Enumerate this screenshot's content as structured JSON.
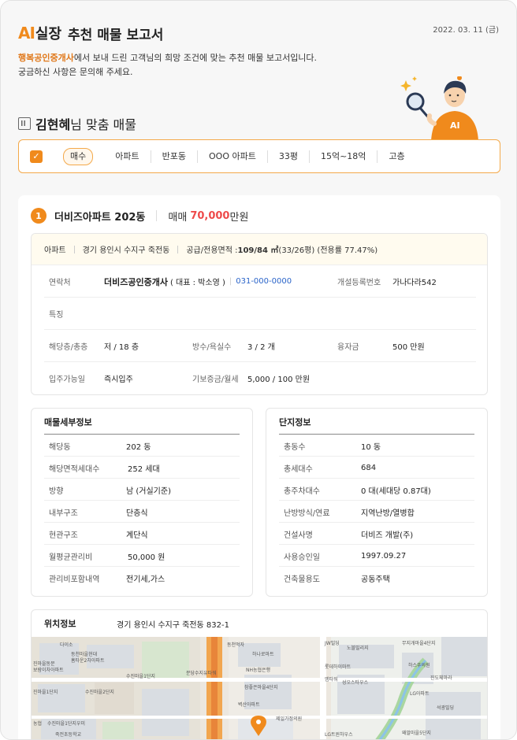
{
  "header": {
    "logo_ai": "AI",
    "logo_sil": "실장",
    "title": "추천 매물 보고서",
    "date": "2022. 03. 11 (금)"
  },
  "intro": {
    "brand": "행복공인중개사",
    "line1_rest": "에서 보내 드린 고객님의 희망 조건에 맞는 추천 매물 보고서입니다.",
    "line2": "궁금하신 사항은 문의해 주세요."
  },
  "section": {
    "customer_name": "김현혜",
    "title_rest": "님 맞춤 매물"
  },
  "filter": {
    "checked": true,
    "tags": [
      "매수",
      "아파트",
      "반포동",
      "OOO 아파트",
      "33평",
      "15억~18억",
      "고층"
    ]
  },
  "property": {
    "number": "1",
    "name": "더비즈아파트 202동",
    "deal_label": "매매",
    "price": "70,000",
    "price_unit": "만원",
    "summary": {
      "type": "아파트",
      "address": "경기 용인시 수지구 죽전동",
      "area_label": "공급/전용면적 : ",
      "area_value": "109/84 ㎡",
      "area_extra": " (33/26평) (전용률 77.47%)"
    },
    "contact": {
      "label": "연락처",
      "agency": "더비즈공인중개사",
      "ceo": "( 대표 : 박소영 )",
      "phone": "031-000-0000",
      "reg_label": "개설등록번호",
      "reg_value": "가나다라542"
    },
    "feature_label": "특징",
    "floor_label": "해당층/총층",
    "floor_value": "저 / 18 층",
    "rooms_label": "방수/욕실수",
    "rooms_value": "3 / 2 개",
    "loan_label": "융자금",
    "loan_value": "500 만원",
    "movein_label": "입주가능일",
    "movein_value": "즉시입주",
    "deposit_label": "기보증금/월세",
    "deposit_value": "5,000 / 100 만원"
  },
  "detail": {
    "title": "매물세부정보",
    "rows": [
      {
        "label": "해당동",
        "value": "202 동"
      },
      {
        "label": "해당면적세대수",
        "value": "252 세대"
      },
      {
        "label": "방향",
        "value": "남 (거실기준)"
      },
      {
        "label": "내부구조",
        "value": "단층식"
      },
      {
        "label": "현관구조",
        "value": "계단식"
      },
      {
        "label": "월평균관리비",
        "value": "50,000 원"
      },
      {
        "label": "관리비포함내역",
        "value": "전기세,가스"
      }
    ]
  },
  "complex": {
    "title": "단지정보",
    "rows": [
      {
        "label": "총동수",
        "value": "10 동"
      },
      {
        "label": "총세대수",
        "value": "684"
      },
      {
        "label": "총주차대수",
        "value": "0 대(세대당 0.87대)"
      },
      {
        "label": "난방방식/연료",
        "value": "지역난방/열병합"
      },
      {
        "label": "건설사명",
        "value": "더비즈 개발(주)"
      },
      {
        "label": "사용승인일",
        "value": "1997.09.27"
      },
      {
        "label": "건축물용도",
        "value": "공동주택"
      }
    ]
  },
  "location": {
    "title": "위치정보",
    "address": "경기 용인시 수지구 죽전동 832-1"
  },
  "colors": {
    "accent": "#f08a1c",
    "price": "#ee4a4a",
    "phone": "#2a64c9"
  }
}
